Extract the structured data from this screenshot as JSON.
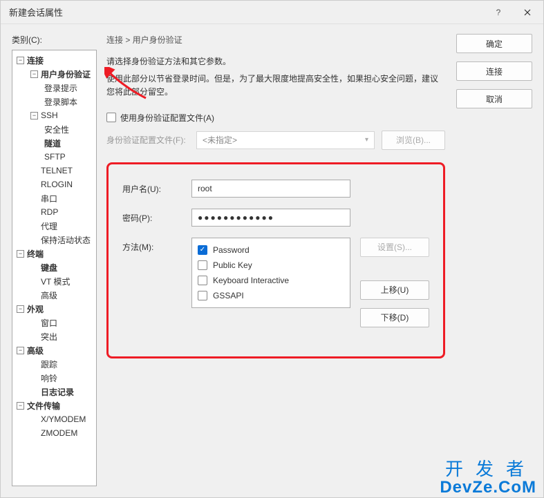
{
  "window": {
    "title": "新建会话属性"
  },
  "category_label": "类别(C):",
  "tree": {
    "conn": "连接",
    "auth": "用户身份验证",
    "login_prompt": "登录提示",
    "login_script": "登录脚本",
    "ssh": "SSH",
    "security": "安全性",
    "tunnel": "隧道",
    "sftp": "SFTP",
    "telnet": "TELNET",
    "rlogin": "RLOGIN",
    "serial": "串口",
    "rdp": "RDP",
    "proxy": "代理",
    "keepalive": "保持活动状态",
    "terminal": "终端",
    "keyboard": "键盘",
    "vtmode": "VT 模式",
    "advanced_t": "高级",
    "appearance": "外观",
    "window_n": "窗口",
    "highlight": "突出",
    "advanced": "高级",
    "trace": "跟踪",
    "bell": "响铃",
    "log": "日志记录",
    "ft": "文件传输",
    "xymodem": "X/YMODEM",
    "zmodem": "ZMODEM"
  },
  "breadcrumb": "连接 > 用户身份验证",
  "desc1": "请选择身份验证方法和其它参数。",
  "desc2": "使用此部分以节省登录时间。但是，为了最大限度地提高安全性，如果担心安全问题，建议您将此部分留空。",
  "chk_profile": "使用身份验证配置文件(A)",
  "profile_label": "身份验证配置文件(F):",
  "profile_value": "<未指定>",
  "browse": "浏览(B)...",
  "fields": {
    "username_label": "用户名(U):",
    "username_value": "root",
    "password_label": "密码(P):",
    "password_value": "●●●●●●●●●●●●",
    "method_label": "方法(M):"
  },
  "methods": {
    "password": "Password",
    "publickey": "Public Key",
    "kbi": "Keyboard Interactive",
    "gssapi": "GSSAPI"
  },
  "method_buttons": {
    "setup": "设置(S)...",
    "up": "上移(U)",
    "down": "下移(D)"
  },
  "buttons": {
    "ok": "确定",
    "connect": "连接",
    "cancel": "取消"
  },
  "watermark": {
    "l1": "开发者",
    "l2": "DevZe.CoM"
  }
}
